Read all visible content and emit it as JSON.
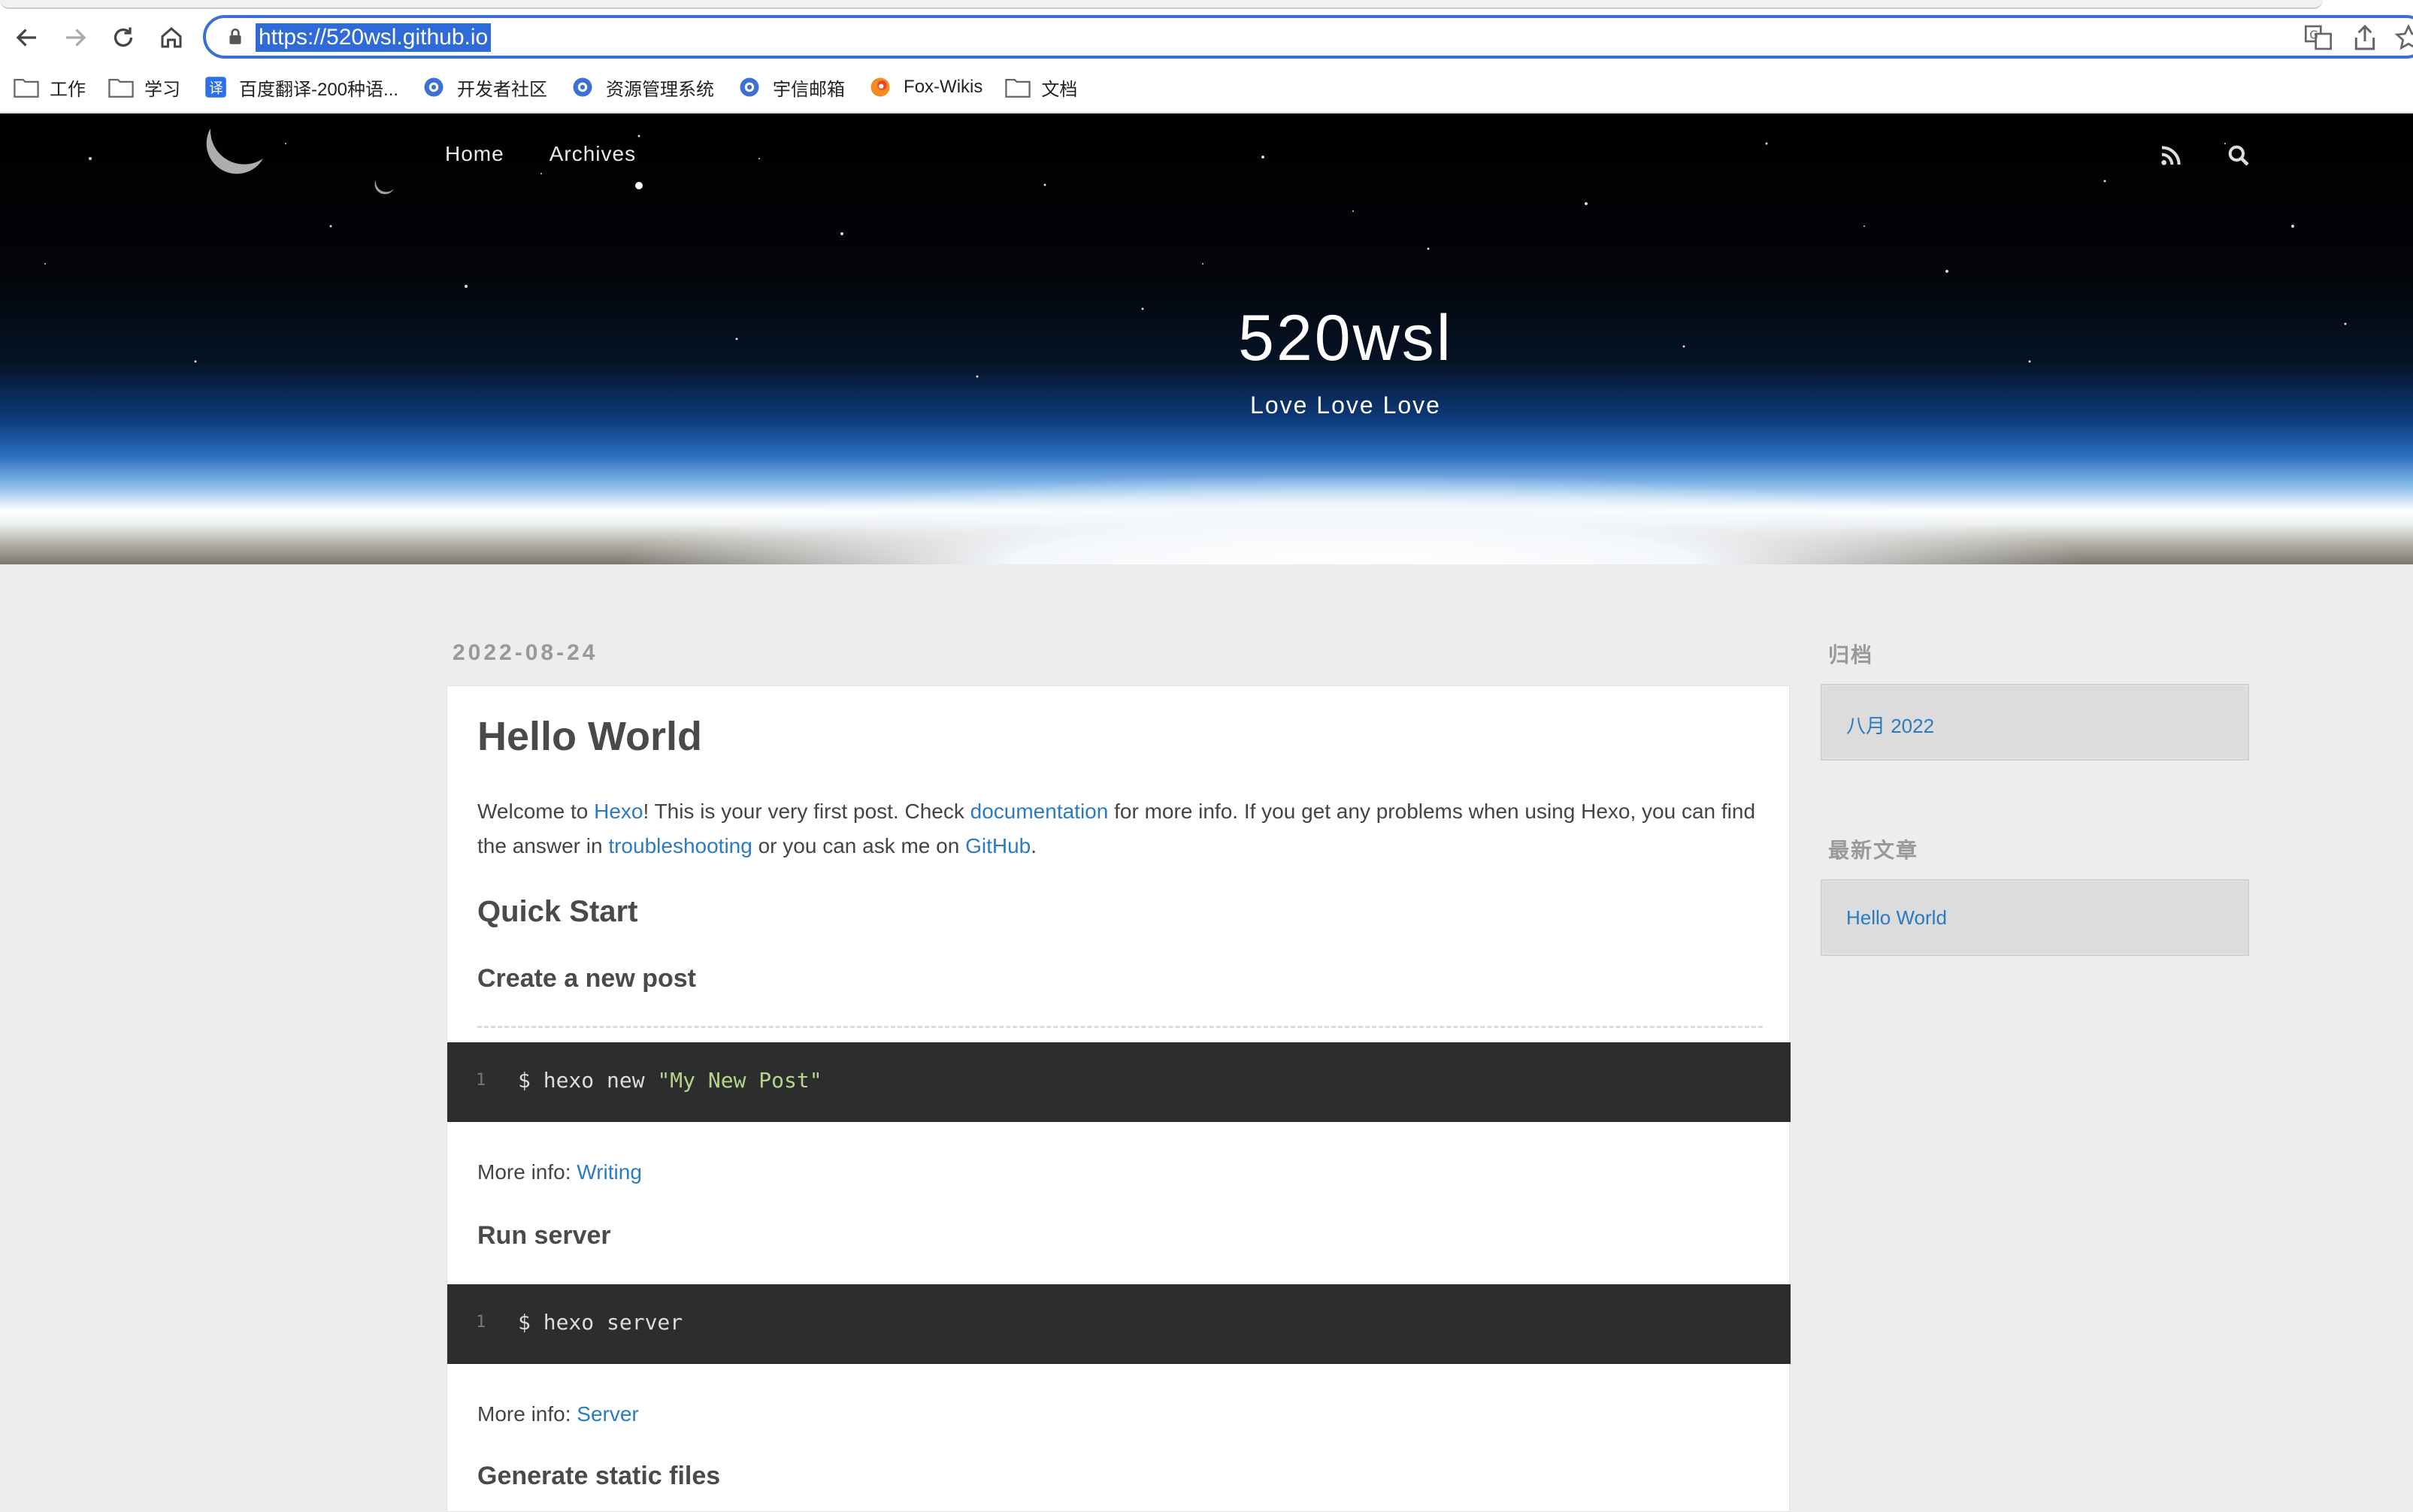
{
  "browser": {
    "url": "https://520wsl.github.io",
    "bookmarks": [
      {
        "label": "工作",
        "icon": "folder-icon"
      },
      {
        "label": "学习",
        "icon": "folder-icon"
      },
      {
        "label": "百度翻译-200种语...",
        "icon": "translate-icon"
      },
      {
        "label": "开发者社区",
        "icon": "globe-gear-icon"
      },
      {
        "label": "资源管理系统",
        "icon": "globe-gear-icon"
      },
      {
        "label": "宇信邮箱",
        "icon": "globe-gear-icon"
      },
      {
        "label": "Fox-Wikis",
        "icon": "fox-icon"
      },
      {
        "label": "文档",
        "icon": "folder-icon"
      }
    ]
  },
  "site": {
    "nav": [
      "Home",
      "Archives"
    ],
    "title": "520wsl",
    "subtitle": "Love Love Love",
    "icons": [
      "rss-icon",
      "search-icon"
    ]
  },
  "post": {
    "date": "2022-08-24",
    "title": "Hello World",
    "intro": {
      "t1": "Welcome to ",
      "l1": "Hexo",
      "t2": "! This is your very first post. Check ",
      "l2": "documentation",
      "t3": " for more info. If you get any problems when using Hexo, you can find the answer in ",
      "l3": "troubleshooting",
      "t4": " or you can ask me on ",
      "l4": "GitHub",
      "t5": "."
    },
    "h_quick_start": "Quick Start",
    "h_create_post": "Create a new post",
    "code1": {
      "line": "1",
      "cmd": "$ hexo new ",
      "str": "\"My New Post\""
    },
    "more1": {
      "label": "More info: ",
      "link": "Writing"
    },
    "h_run_server": "Run server",
    "code2": {
      "line": "1",
      "cmd": "$ hexo server"
    },
    "more2": {
      "label": "More info: ",
      "link": "Server"
    },
    "h_generate": "Generate static files"
  },
  "sidebar": {
    "archive_heading": "归档",
    "archive_item": "八月 2022",
    "recent_heading": "最新文章",
    "recent_item": "Hello World"
  },
  "colors": {
    "link": "#2b7bc2",
    "code_bg": "#2d2d2d",
    "url_highlight": "#2e6bd8"
  }
}
